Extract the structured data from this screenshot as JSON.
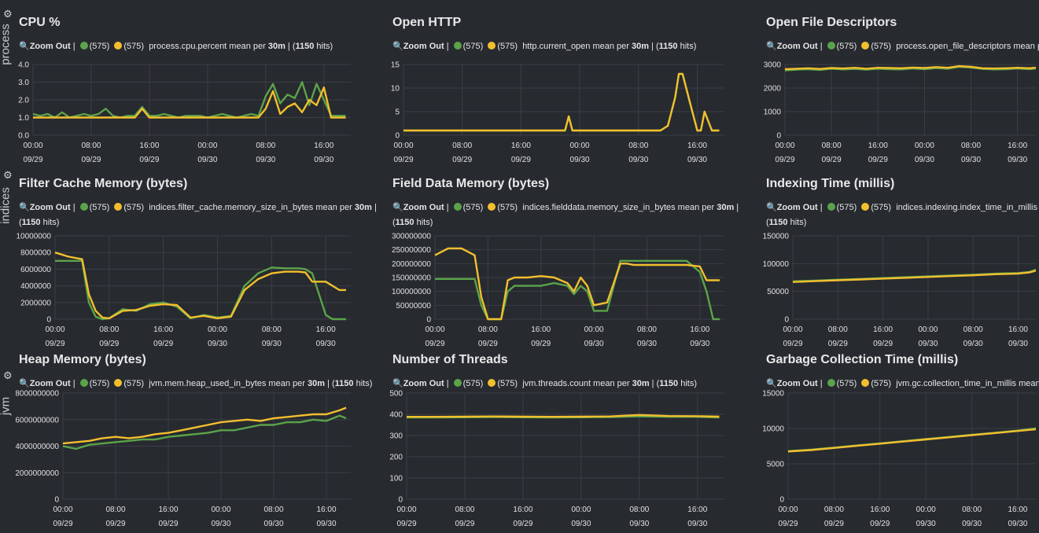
{
  "rows": [
    {
      "label": "process",
      "icon": "gear-icon"
    },
    {
      "label": "indices",
      "icon": "gear-icon"
    },
    {
      "label": "jvm",
      "icon": "gear-icon"
    }
  ],
  "colors": {
    "series_a": "#5ba34a",
    "series_b": "#f2bf2e",
    "grid": "#3b3f45",
    "axis_text": "#e0e0e0"
  },
  "x_ticks": [
    {
      "time": "00:00",
      "date": "09/29"
    },
    {
      "time": "08:00",
      "date": "09/29"
    },
    {
      "time": "16:00",
      "date": "09/29"
    },
    {
      "time": "00:00",
      "date": "09/30"
    },
    {
      "time": "08:00",
      "date": "09/30"
    },
    {
      "time": "16:00",
      "date": "09/30"
    }
  ],
  "panels": [
    {
      "title": "CPU %",
      "zoom": "Zoom Out",
      "count_a": "(575)",
      "count_b": "(575)",
      "query": "process.cpu.percent mean per ",
      "interval": "30m",
      "sep": " | (",
      "hits": "1150",
      "hits_suffix": " hits)"
    },
    {
      "title": "Open HTTP",
      "zoom": "Zoom Out",
      "count_a": "(575)",
      "count_b": "(575)",
      "query": "http.current_open mean per ",
      "interval": "30m",
      "sep": " | (",
      "hits": "1150",
      "hits_suffix": " hits)"
    },
    {
      "title": "Open File Descriptors",
      "zoom": "Zoom Out",
      "count_a": "(575)",
      "count_b": "(575)",
      "query": "process.open_file_descriptors mean per",
      "interval": "",
      "sep": "",
      "hits": "",
      "hits_suffix": ""
    },
    {
      "title": "Filter Cache Memory (bytes)",
      "zoom": "Zoom Out",
      "count_a": "(575)",
      "count_b": "(575)",
      "query": "indices.filter_cache.memory_size_in_bytes mean per ",
      "interval": "30m",
      "sep": " | (",
      "hits": "1150",
      "hits_suffix": " hits)"
    },
    {
      "title": "Field Data Memory (bytes)",
      "zoom": "Zoom Out",
      "count_a": "(575)",
      "count_b": "(575)",
      "query": "indices.fielddata.memory_size_in_bytes mean per ",
      "interval": "30m",
      "sep": " | (",
      "hits": "1150",
      "hits_suffix": " hits)"
    },
    {
      "title": "Indexing Time (millis)",
      "zoom": "Zoom Out",
      "count_a": "(575)",
      "count_b": "(575)",
      "query": "indices.indexing.index_time_in_millis mean",
      "interval": "",
      "sep": " (",
      "hits": "1150",
      "hits_suffix": " hits)"
    },
    {
      "title": "Heap Memory (bytes)",
      "zoom": "Zoom Out",
      "count_a": "(575)",
      "count_b": "(575)",
      "query": "jvm.mem.heap_used_in_bytes mean per ",
      "interval": "30m",
      "sep": " | (",
      "hits": "1150",
      "hits_suffix": " hits)"
    },
    {
      "title": "Number of Threads",
      "zoom": "Zoom Out",
      "count_a": "(575)",
      "count_b": "(575)",
      "query": "jvm.threads.count mean per ",
      "interval": "30m",
      "sep": " | (",
      "hits": "1150",
      "hits_suffix": " hits)"
    },
    {
      "title": "Garbage Collection Time (millis)",
      "zoom": "Zoom Out",
      "count_a": "(575)",
      "count_b": "(575)",
      "query": "jvm.gc.collection_time_in_millis mean per",
      "interval": "",
      "sep": "",
      "hits": "",
      "hits_suffix": ""
    }
  ],
  "chart_data": [
    {
      "type": "line",
      "title": "CPU %",
      "x_hours": [
        0,
        1,
        2,
        3,
        4,
        5,
        6,
        7,
        8,
        9,
        10,
        11,
        12,
        13,
        14,
        15,
        16,
        17,
        18,
        19,
        20,
        21,
        22,
        23,
        24,
        25,
        26,
        27,
        28,
        29,
        30,
        31,
        32,
        33,
        34,
        35,
        36,
        37,
        38,
        39,
        40,
        41,
        42,
        43
      ],
      "ylim": [
        0,
        4
      ],
      "yticks": [
        "0.0",
        "1.0",
        "2.0",
        "3.0",
        "4.0"
      ],
      "series": [
        {
          "values": [
            1.2,
            1.1,
            1.2,
            1.0,
            1.3,
            1.0,
            1.1,
            1.2,
            1.1,
            1.2,
            1.5,
            1.1,
            1.0,
            1.1,
            1.1,
            1.6,
            1.1,
            1.1,
            1.2,
            1.1,
            1.0,
            1.1,
            1.1,
            1.1,
            1.0,
            1.1,
            1.2,
            1.1,
            1.0,
            1.1,
            1.2,
            1.1,
            2.2,
            2.9,
            1.8,
            2.3,
            2.1,
            3.0,
            1.7,
            2.9,
            2.0,
            1.1,
            1.1,
            1.1
          ]
        },
        {
          "values": [
            1.0,
            1.0,
            1.0,
            1.0,
            1.0,
            1.0,
            1.0,
            1.0,
            1.0,
            1.0,
            1.0,
            1.0,
            1.0,
            1.0,
            1.0,
            1.5,
            1.0,
            1.0,
            1.0,
            1.0,
            1.0,
            1.0,
            1.0,
            1.0,
            1.0,
            1.0,
            1.0,
            1.0,
            1.0,
            1.0,
            1.0,
            1.0,
            1.5,
            2.5,
            1.2,
            1.6,
            1.8,
            1.3,
            2.0,
            1.7,
            2.7,
            1.0,
            1.0,
            1.0
          ]
        }
      ]
    },
    {
      "type": "line",
      "title": "Open HTTP",
      "x_hours": [
        0,
        4,
        8,
        12,
        16,
        20,
        22,
        22.5,
        23,
        27,
        31,
        35,
        36,
        37,
        37.5,
        38,
        39,
        40,
        40.5,
        41,
        42,
        43
      ],
      "ylim": [
        0,
        15
      ],
      "yticks": [
        "0",
        "5",
        "10",
        "15"
      ],
      "series": [
        {
          "values": [
            1,
            1,
            1,
            1,
            1,
            1,
            1,
            4,
            1,
            1,
            1,
            1,
            2,
            8,
            13,
            13,
            7,
            1,
            1,
            5,
            1,
            1
          ]
        },
        {
          "values": [
            1,
            1,
            1,
            1,
            1,
            1,
            1,
            4,
            1,
            1,
            1,
            1,
            2,
            8,
            13,
            13,
            7,
            1,
            1,
            5,
            1,
            1
          ]
        }
      ]
    },
    {
      "type": "line",
      "title": "Open File Descriptors",
      "x_hours": [
        0,
        2,
        4,
        6,
        8,
        10,
        12,
        14,
        16,
        18,
        20,
        22,
        24,
        26,
        28,
        30,
        32,
        34,
        36,
        38,
        40,
        42,
        44,
        46,
        48
      ],
      "ylim": [
        0,
        3000
      ],
      "yticks": [
        "0",
        "1000",
        "2000",
        "3000"
      ],
      "series": [
        {
          "values": [
            2750,
            2780,
            2800,
            2770,
            2820,
            2790,
            2810,
            2780,
            2820,
            2800,
            2790,
            2830,
            2800,
            2850,
            2820,
            2900,
            2870,
            2810,
            2790,
            2800,
            2830,
            2800,
            2850,
            2820,
            2800
          ]
        },
        {
          "values": [
            2800,
            2820,
            2840,
            2810,
            2850,
            2830,
            2860,
            2820,
            2860,
            2850,
            2840,
            2870,
            2850,
            2890,
            2860,
            2930,
            2900,
            2840,
            2830,
            2840,
            2860,
            2840,
            2880,
            2860,
            2840
          ]
        }
      ]
    },
    {
      "type": "line",
      "title": "Filter Cache Memory (bytes)",
      "x_hours": [
        0,
        2,
        4,
        5,
        6,
        7,
        8,
        10,
        12,
        14,
        16,
        18,
        20,
        22,
        24,
        26,
        28,
        30,
        32,
        34,
        36,
        37,
        38,
        39,
        40,
        41,
        42,
        43
      ],
      "ylim": [
        0,
        10000000
      ],
      "yticks": [
        "0",
        "2000000",
        "4000000",
        "6000000",
        "8000000",
        "10000000"
      ],
      "series": [
        {
          "values": [
            7000000,
            7000000,
            7000000,
            2000000,
            300000,
            0,
            100000,
            1200000,
            1000000,
            1800000,
            2000000,
            1500000,
            100000,
            500000,
            200000,
            400000,
            4000000,
            5500000,
            6200000,
            6100000,
            6100000,
            6000000,
            5500000,
            3000000,
            500000,
            0,
            0,
            0
          ]
        },
        {
          "values": [
            8000000,
            7500000,
            7200000,
            3000000,
            1000000,
            200000,
            100000,
            1000000,
            1100000,
            1600000,
            1800000,
            1700000,
            200000,
            400000,
            100000,
            300000,
            3500000,
            4800000,
            5500000,
            5700000,
            5700000,
            5600000,
            4500000,
            4500000,
            4500000,
            4000000,
            3500000,
            3500000
          ]
        }
      ]
    },
    {
      "type": "line",
      "title": "Field Data Memory (bytes)",
      "x_hours": [
        0,
        2,
        4,
        6,
        7,
        8,
        9,
        10,
        11,
        12,
        14,
        16,
        18,
        20,
        21,
        22,
        23,
        24,
        26,
        28,
        29,
        30,
        32,
        34,
        36,
        38,
        40,
        41,
        42,
        43
      ],
      "ylim": [
        0,
        300000000
      ],
      "yticks": [
        "0",
        "50000000",
        "100000000",
        "150000000",
        "200000000",
        "250000000",
        "300000000"
      ],
      "series": [
        {
          "values": [
            145000000,
            145000000,
            145000000,
            145000000,
            50000000,
            0,
            0,
            0,
            100000000,
            120000000,
            120000000,
            120000000,
            130000000,
            120000000,
            90000000,
            120000000,
            100000000,
            30000000,
            30000000,
            210000000,
            210000000,
            210000000,
            210000000,
            210000000,
            210000000,
            210000000,
            170000000,
            100000000,
            0,
            0
          ]
        },
        {
          "values": [
            230000000,
            255000000,
            255000000,
            230000000,
            80000000,
            0,
            0,
            0,
            140000000,
            150000000,
            150000000,
            155000000,
            150000000,
            130000000,
            100000000,
            150000000,
            120000000,
            50000000,
            60000000,
            200000000,
            200000000,
            195000000,
            195000000,
            195000000,
            195000000,
            195000000,
            190000000,
            140000000,
            140000000,
            140000000
          ]
        }
      ]
    },
    {
      "type": "line",
      "title": "Indexing Time (millis)",
      "x_hours": [
        0,
        4,
        8,
        12,
        16,
        20,
        24,
        28,
        32,
        36,
        40,
        42,
        44,
        46,
        48
      ],
      "ylim": [
        0,
        150000
      ],
      "yticks": [
        "0",
        "50000",
        "100000",
        "150000"
      ],
      "series": [
        {
          "values": [
            68000,
            69500,
            71000,
            72500,
            74000,
            75500,
            77000,
            78500,
            80000,
            82000,
            83000,
            85000,
            92000,
            101000,
            108000
          ]
        },
        {
          "values": [
            67000,
            68500,
            70000,
            71500,
            73000,
            74500,
            76000,
            77500,
            79000,
            81000,
            82000,
            84000,
            90000,
            98000,
            104000
          ]
        }
      ]
    },
    {
      "type": "line",
      "title": "Heap Memory (bytes)",
      "x_hours": [
        0,
        2,
        4,
        6,
        8,
        10,
        12,
        14,
        16,
        18,
        20,
        22,
        24,
        26,
        28,
        30,
        32,
        34,
        36,
        38,
        40,
        42,
        43
      ],
      "ylim": [
        0,
        8000000000
      ],
      "yticks": [
        "0",
        "2000000000",
        "4000000000",
        "6000000000",
        "8000000000"
      ],
      "series": [
        {
          "values": [
            4000000000,
            3800000000,
            4100000000,
            4200000000,
            4300000000,
            4400000000,
            4500000000,
            4500000000,
            4700000000,
            4800000000,
            4900000000,
            5000000000,
            5200000000,
            5200000000,
            5400000000,
            5600000000,
            5600000000,
            5800000000,
            5800000000,
            6000000000,
            5900000000,
            6300000000,
            6100000000
          ]
        },
        {
          "values": [
            4200000000,
            4300000000,
            4400000000,
            4600000000,
            4700000000,
            4600000000,
            4700000000,
            4900000000,
            5000000000,
            5200000000,
            5400000000,
            5600000000,
            5800000000,
            5900000000,
            6000000000,
            5900000000,
            6100000000,
            6200000000,
            6300000000,
            6400000000,
            6400000000,
            6700000000,
            6900000000
          ]
        }
      ]
    },
    {
      "type": "line",
      "title": "Number of Threads",
      "x_hours": [
        0,
        4,
        8,
        12,
        16,
        20,
        24,
        28,
        32,
        36,
        40,
        43
      ],
      "ylim": [
        0,
        500
      ],
      "yticks": [
        "0",
        "100",
        "200",
        "300",
        "400",
        "500"
      ],
      "series": [
        {
          "values": [
            385,
            385,
            386,
            387,
            386,
            385,
            386,
            387,
            390,
            388,
            388,
            385
          ]
        },
        {
          "values": [
            388,
            388,
            389,
            390,
            389,
            388,
            389,
            390,
            397,
            392,
            391,
            389
          ]
        }
      ]
    },
    {
      "type": "line",
      "title": "Garbage Collection Time (millis)",
      "x_hours": [
        0,
        4,
        8,
        12,
        16,
        20,
        24,
        28,
        32,
        36,
        40,
        44,
        48
      ],
      "ylim": [
        0,
        15000
      ],
      "yticks": [
        "0",
        "5000",
        "10000",
        "15000"
      ],
      "series": [
        {
          "values": [
            6800,
            7000,
            7300,
            7600,
            7900,
            8200,
            8500,
            8800,
            9100,
            9400,
            9700,
            10100,
            10700
          ]
        },
        {
          "values": [
            6750,
            6950,
            7250,
            7550,
            7850,
            8150,
            8450,
            8750,
            9050,
            9350,
            9650,
            9950,
            10400
          ]
        }
      ]
    }
  ]
}
